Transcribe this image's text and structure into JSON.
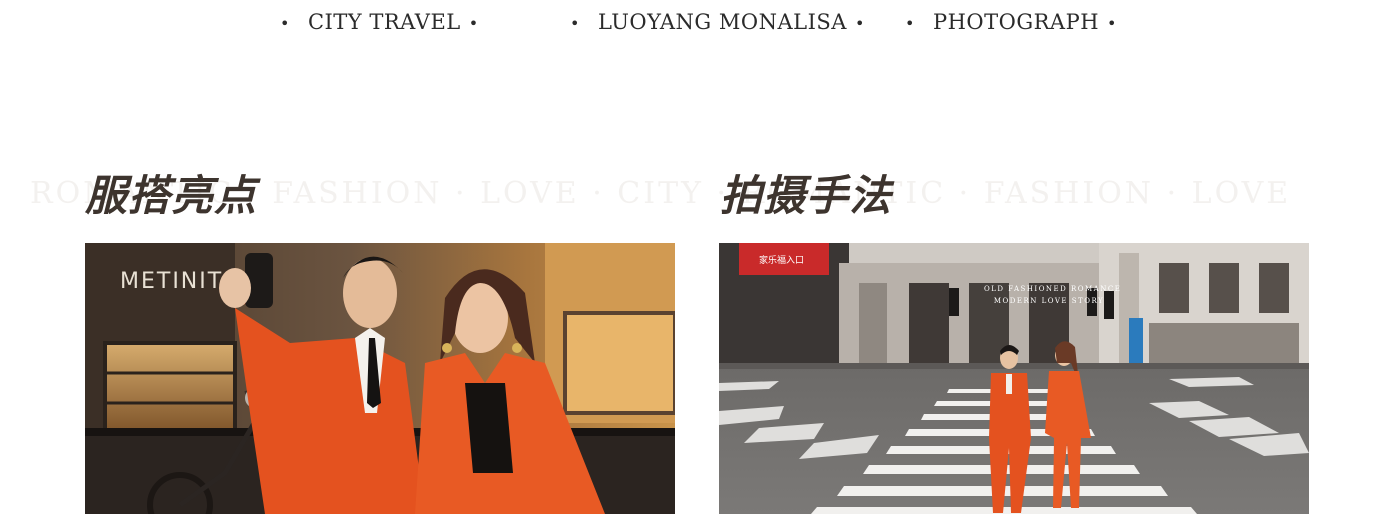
{
  "tags": [
    {
      "label": "CITY TRAVEL"
    },
    {
      "label": "LUOYANG MONALISA"
    },
    {
      "label": "PHOTOGRAPH"
    }
  ],
  "tag_bullet": "•",
  "watermark_text": "ROMANTIC · FASHION · LOVE · CITY · ROMANTIC · FASHION · LOVE",
  "sections": {
    "left_heading": "服搭亮点",
    "right_heading": "拍摄手法"
  },
  "photos": {
    "left": {
      "scene": "couple in orange suits taking a selfie in front of a cafe",
      "shop_sign": "METINIT"
    },
    "right": {
      "scene": "couple in orange suits on a zebra crossing in a city street",
      "sign_text": "家乐福入口",
      "caption_line1": "OLD FASHIONED ROMANCE",
      "caption_line2": "MODERN LOVE STORY"
    }
  },
  "colors": {
    "heading": "#3d342e",
    "tag_text": "#2b2b2b",
    "suit_orange": "#e4521f",
    "cafe_warm": "#c98a3a",
    "street_grey": "#6f6d6b"
  }
}
